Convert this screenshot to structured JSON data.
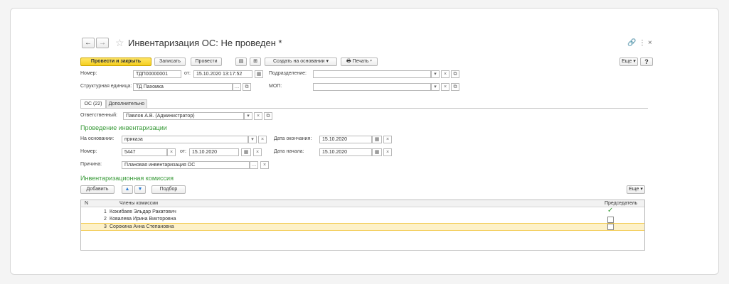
{
  "window": {
    "title": "Инвентаризация ОС: Не проведен *",
    "link_icon": "link-icon",
    "menu_icon": "more-vertical-icon",
    "close_icon": "close-icon",
    "back_icon": "arrow-left-icon",
    "forward_icon": "arrow-right-icon",
    "star_icon": "star-icon"
  },
  "toolbar": {
    "post_and_close": "Провести и закрыть",
    "save": "Записать",
    "post": "Провести",
    "create_based_on": "Создать на основании",
    "print": "Печать",
    "more": "Еще",
    "help": "?"
  },
  "header": {
    "number_label": "Номер:",
    "number_value": "ТДП00000001",
    "date_label": "от:",
    "date_value": "15.10.2020 13:17:52",
    "subdivision_label": "Подразделение:",
    "subdivision_value": "",
    "unit_label": "Структурная единица:",
    "unit_value": "ТД Пахомка",
    "mol_label": "МОП:",
    "mol_value": ""
  },
  "tabs": [
    {
      "label": "ОС (22)"
    },
    {
      "label": "Дополнительно"
    }
  ],
  "responsible": {
    "label": "Ответственный:",
    "value": "Павлов А.В. (Администратор)"
  },
  "inventory": {
    "section_title": "Проведение инвентаризации",
    "basis_label": "На основании:",
    "basis_value": "приказа",
    "end_date_label": "Дата окончания:",
    "end_date_value": "15.10.2020",
    "number_label": "Номер:",
    "number_value": "5447",
    "from_label": "от:",
    "from_value": "15.10.2020",
    "start_date_label": "Дата начала:",
    "start_date_value": "15.10.2020",
    "reason_label": "Причина:",
    "reason_value": "Плановая инвентаризация ОС"
  },
  "commission": {
    "section_title": "Инвентаризационная комиссия",
    "add_button": "Добавить",
    "pick_button": "Подбор",
    "more_button": "Еще",
    "columns": {
      "n": "N",
      "members": "Члены комиссии",
      "chairman": "Председатель"
    },
    "rows": [
      {
        "n": "1",
        "name": "Кожибаев Эльдар Ракатович",
        "chairman": true
      },
      {
        "n": "2",
        "name": "Ковалева Ирина Викторовна",
        "chairman": false
      },
      {
        "n": "3",
        "name": "Сорокина Анна Степановна",
        "chairman": false
      }
    ]
  },
  "colors": {
    "primary": "#f5cf1e",
    "section": "#3a9b3a",
    "selected_row": "#fdf1c8"
  }
}
